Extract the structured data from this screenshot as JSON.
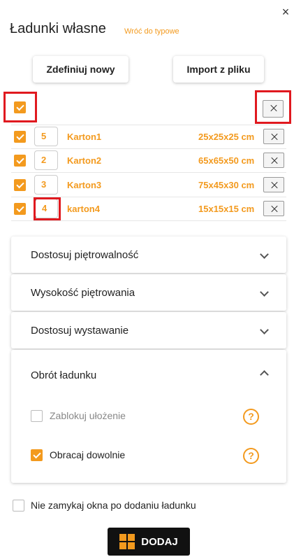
{
  "header": {
    "title": "Ładunki własne",
    "back_link": "Wróć do typowe",
    "close_symbol": "×"
  },
  "toolbar": {
    "define_label": "Zdefiniuj nowy",
    "import_label": "Import z pliku"
  },
  "items": [
    {
      "qty": "5",
      "name": "Karton1",
      "dims": "25x25x25 cm",
      "checked": true
    },
    {
      "qty": "2",
      "name": "Karton2",
      "dims": "65x65x50 cm",
      "checked": true
    },
    {
      "qty": "3",
      "name": "Karton3",
      "dims": "75x45x30 cm",
      "checked": true
    },
    {
      "qty": "4",
      "name": "karton4",
      "dims": "15x15x15 cm",
      "checked": true
    }
  ],
  "sections": [
    {
      "label": "Dostosuj piętrowalność",
      "expanded": false
    },
    {
      "label": "Wysokość piętrowania",
      "expanded": false
    },
    {
      "label": "Dostosuj wystawanie",
      "expanded": false
    },
    {
      "label": "Obrót ładunku",
      "expanded": true
    }
  ],
  "rotation_options": [
    {
      "label": "Zablokuj ułożenie",
      "checked": false,
      "help": "?"
    },
    {
      "label": "Obracaj dowolnie",
      "checked": true,
      "help": "?"
    }
  ],
  "keep_open_label": "Nie zamykaj okna po dodaniu ładunku",
  "add_button_label": "DODAJ",
  "colors": {
    "accent": "#f39a1e",
    "highlight": "#e0191f",
    "button_dark": "#111111"
  }
}
